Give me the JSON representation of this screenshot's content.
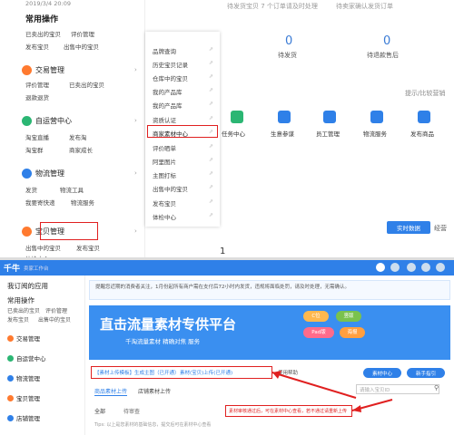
{
  "top_panel": {
    "left_sidebar": {
      "clipped_header": "2019/3/4 20:09",
      "common_ops_title": "常用操作",
      "quick_links": [
        "已卖出的宝贝",
        "评价管理",
        "发布宝贝",
        "出售中的宝贝"
      ],
      "sections": [
        {
          "label": "交易管理",
          "links": [
            "评价管理",
            "已卖出的宝贝",
            "退款退货"
          ]
        },
        {
          "label": "自运营中心",
          "links": [
            "淘宝直播",
            "发布淘",
            "淘宝群",
            "商家成长"
          ]
        },
        {
          "label": "物流管理",
          "links": [
            "发货",
            "物流工具",
            "我要寄快递",
            "物流服务"
          ]
        },
        {
          "label": "宝贝管理",
          "links": [
            "出售中的宝贝",
            "发布宝贝",
            "体检中心"
          ]
        }
      ]
    },
    "flyout_menu": {
      "items": [
        "品牌查询",
        "历史宝贝记录",
        "仓库中的宝贝",
        "我的产品库",
        "我的产品库",
        "资质认证",
        "商家素材中心",
        "评价晒单",
        "阿里图片",
        "主图打标",
        "出售中的宝贝",
        "发布宝贝",
        "体检中心"
      ],
      "highlighted": "商家素材中心"
    },
    "top_notices": [
      "待发货宝贝 7 个订单请及时处理",
      "待卖家确认发货订单"
    ],
    "stats": [
      {
        "value": "0",
        "label": "待发货"
      },
      {
        "value": "0",
        "label": "待退款售后"
      }
    ],
    "right_note": "提示/比较营销",
    "tools": [
      {
        "label": "任务中心",
        "icon": "calendar-icon",
        "color": "#2bb673"
      },
      {
        "label": "生意参谋",
        "icon": "chat-icon",
        "color": "#2f80e8"
      },
      {
        "label": "员工管理",
        "icon": "people-icon",
        "color": "#2f80e8"
      },
      {
        "label": "物流服务",
        "icon": "box-icon",
        "color": "#2f80e8"
      },
      {
        "label": "发布商品",
        "icon": "send-icon",
        "color": "#2f80e8"
      }
    ],
    "realtime_btn": "实时数据",
    "tab2": "经营",
    "bottom_number": "1"
  },
  "bottom_panel": {
    "header_logo": "千牛",
    "header_sub": "卖家工作台",
    "sidebar": {
      "title": "我订阅的应用",
      "common": "常用操作",
      "links": [
        "已卖出的宝贝",
        "评价管理",
        "发布宝贝",
        "出售中的宝贝"
      ],
      "sections": [
        "交易管理",
        "自运营中心",
        "物流管理",
        "宝贝管理",
        "店铺管理"
      ]
    },
    "notice": "提醒您近期的消费者关注，1月份起所有商户需在支付后72小时内发货，违规将面临处罚，请及时处理，无需确认。",
    "banner_title": "直击流量素材专供平台",
    "banner_sub": "千淘流量素材  精确对焦  服务",
    "banner_tags": [
      "C位",
      "竖版",
      "Pad版",
      "海报"
    ],
    "tabs_row": [
      "【素材上传模板】生成主图（已开通）",
      "素材(宝贝)上传(已开通)",
      "使用帮助"
    ],
    "upload_tabs": [
      "商品素材上传",
      "店铺素材上传"
    ],
    "filter": [
      "全部",
      "待审查"
    ],
    "tip_text": "Tips: 以上是您素材的基础信息，提交后可在素材中心查看",
    "red_note": "素材审核通过后，可在素材中心查看，若不通过请重新上传",
    "search_placeholder": "请输入宝贝ID",
    "btn_labels": [
      "素材中心",
      "新手指引"
    ]
  }
}
